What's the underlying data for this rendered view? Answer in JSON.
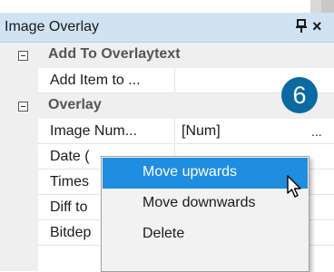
{
  "panel": {
    "title": "Image Overlay",
    "pin_icon": "pin-icon",
    "close_label": "×"
  },
  "categories": [
    {
      "label": "Add To Overlaytext",
      "expanded": true
    },
    {
      "label": "Overlay",
      "expanded": true
    }
  ],
  "rows": {
    "add_item": {
      "name": "Add Item to ...",
      "value": ""
    },
    "image_num": {
      "name": "Image Num...",
      "value": "[Num]",
      "button": "..."
    },
    "date": {
      "name": "Date ("
    },
    "times": {
      "name": "Times"
    },
    "diff": {
      "name": "Diff to"
    },
    "bitdep": {
      "name": "Bitdep"
    }
  },
  "badge": "6",
  "context_menu": {
    "items": [
      "Move upwards",
      "Move downwards",
      "Delete"
    ],
    "hovered": "Move upwards"
  },
  "colors": {
    "titlebar": "#cfe3f3",
    "menu_highlight": "#1f8de0",
    "badge": "#0a6aa1"
  }
}
